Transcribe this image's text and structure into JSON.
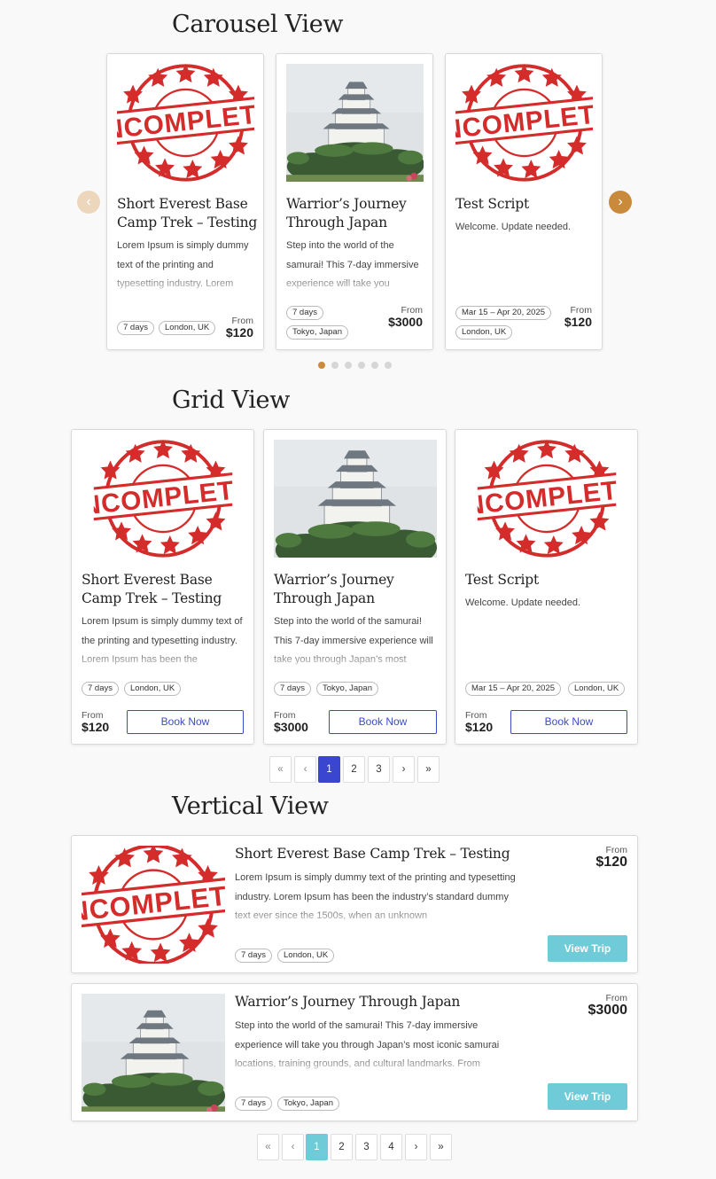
{
  "carousel": {
    "title": "Carousel View",
    "cards": [
      {
        "title": "Short Everest Base Camp Trek – Testing",
        "desc": "Lorem Ipsum is simply dummy text of the printing and typesetting industry. Lorem",
        "tags": [
          "7 days",
          "London, UK"
        ],
        "from": "From",
        "price": "$120"
      },
      {
        "title": "Warrior’s Journey Through Japan",
        "desc": "Step into the world of the samurai! This 7-day immersive experience will take you",
        "tags": [
          "7 days",
          "Tokyo, Japan"
        ],
        "from": "From",
        "price": "$3000"
      },
      {
        "title": "Test Script",
        "desc": "Welcome. Update needed.",
        "tags": [
          "Mar 15 – Apr 20, 2025",
          "London, UK"
        ],
        "from": "From",
        "price": "$120"
      }
    ],
    "prev_icon": "‹",
    "next_icon": "›",
    "accent": "#c98a3c"
  },
  "grid": {
    "title": "Grid View",
    "book_label": "Book Now",
    "cards": [
      {
        "title": "Short Everest Base Camp Trek – Testing",
        "desc": "Lorem Ipsum is simply dummy text of the printing and typesetting industry. Lorem Ipsum has been the",
        "tags": [
          "7 days",
          "London, UK"
        ],
        "from": "From",
        "price": "$120"
      },
      {
        "title": "Warrior’s Journey Through Japan",
        "desc": "Step into the world of the samurai! This 7-day immersive experience will take you through Japan’s most",
        "tags": [
          "7 days",
          "Tokyo, Japan"
        ],
        "from": "From",
        "price": "$3000"
      },
      {
        "title": "Test Script",
        "desc": "Welcome. Update needed.",
        "tags": [
          "Mar 15 – Apr 20, 2025",
          "London, UK"
        ],
        "from": "From",
        "price": "$120"
      }
    ],
    "pagination": [
      "«",
      "‹",
      "1",
      "2",
      "3",
      "›",
      "»"
    ],
    "accent": "#3a45d0"
  },
  "vertical": {
    "title": "Vertical View",
    "view_label": "View Trip",
    "cards": [
      {
        "title": "Short Everest Base Camp Trek – Testing",
        "desc": "Lorem Ipsum is simply dummy text of the printing and typesetting industry. Lorem Ipsum has been the industry’s standard dummy text ever since the 1500s, when an unknown",
        "tags": [
          "7 days",
          "London, UK"
        ],
        "from": "From",
        "price": "$120"
      },
      {
        "title": "Warrior’s Journey Through Japan",
        "desc": "Step into the world of the samurai! This 7-day immersive experience will take you through Japan’s most iconic samurai locations, training grounds, and cultural landmarks. From",
        "tags": [
          "7 days",
          "Tokyo, Japan"
        ],
        "from": "From",
        "price": "$3000"
      }
    ],
    "pagination": [
      "«",
      "‹",
      "1",
      "2",
      "3",
      "4",
      "›",
      "»"
    ],
    "accent": "#6fcbd8"
  },
  "stamp_text": "INCOMPLETE"
}
